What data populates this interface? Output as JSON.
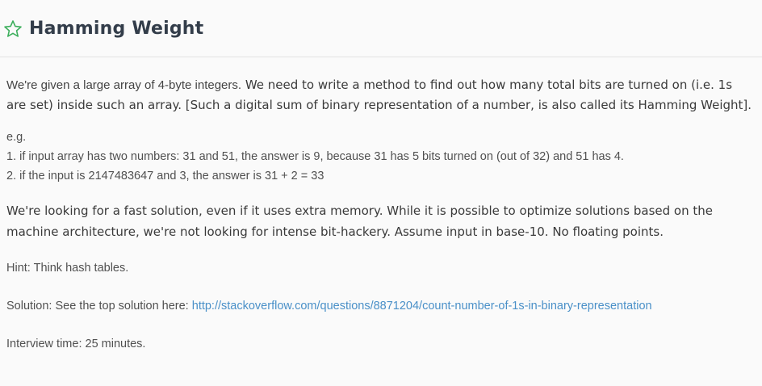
{
  "header": {
    "title": "Hamming Weight",
    "star_icon": "star-outline-icon",
    "accent": "#3cae5c"
  },
  "content": {
    "intro_first": "We're given a large array of 4-byte integers.",
    "intro_rest": " We need to write a method to find out how many total bits are turned on (i.e. 1s are set) inside such an array. [Such a digital sum of binary representation of a number, is also called its Hamming Weight].",
    "eg_label": "e.g.",
    "example_1": "1. if input array has two numbers: 31 and 51, the answer is 9, because 31 has 5 bits turned on (out of 32) and 51 has 4.",
    "example_2": "2. if the input is 2147483647 and 3, the answer is 31 + 2 = 33",
    "paragraph_2": "We're looking for a fast solution, even if it uses extra memory. While it is possible to optimize solutions based on the machine architecture, we're not looking for intense bit-hackery. Assume input in base-10. No floating points.",
    "hint": "Hint: Think hash tables.",
    "solution_prefix": "Solution: See the top solution here: ",
    "solution_link": "http://stackoverflow.com/questions/8871204/count-number-of-1s-in-binary-representation",
    "interview_time": "Interview time: 25 minutes."
  }
}
